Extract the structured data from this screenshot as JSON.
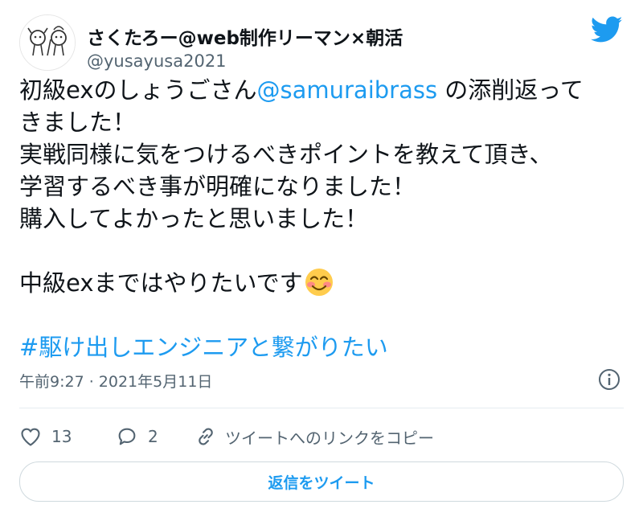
{
  "user": {
    "display_name": "さくたろー@web制作リーマン×朝活",
    "handle": "@yusayusa2021"
  },
  "tweet": {
    "line1_pre": "初級exのしょうごさん",
    "mention": "@samuraibrass",
    "line1_post": " の添削返って",
    "line2": "きました！",
    "line3": "実戦同様に気をつけるべきポイントを教えて頂き、",
    "line4": "学習するべき事が明確になりました！",
    "line5": "購入してよかったと思いました！",
    "line6": "中級exまではやりたいです",
    "emoji": "smiling-face-with-smiling-eyes",
    "hashtag": "#駆け出しエンジニアと繋がりたい"
  },
  "meta": {
    "timestamp": "午前9:27 · 2021年5月11日"
  },
  "actions": {
    "like_count": "13",
    "reply_count": "2",
    "copy_link_label": "ツイートへのリンクをコピー"
  },
  "reply_button_label": "返信をツイート",
  "icons": [
    "twitter-bird-icon",
    "info-icon",
    "heart-icon",
    "comment-icon",
    "link-icon"
  ],
  "colors": {
    "accent": "#1d9bf0",
    "text": "#0f1419",
    "secondary_text": "#536471",
    "border": "#cfd9de"
  }
}
